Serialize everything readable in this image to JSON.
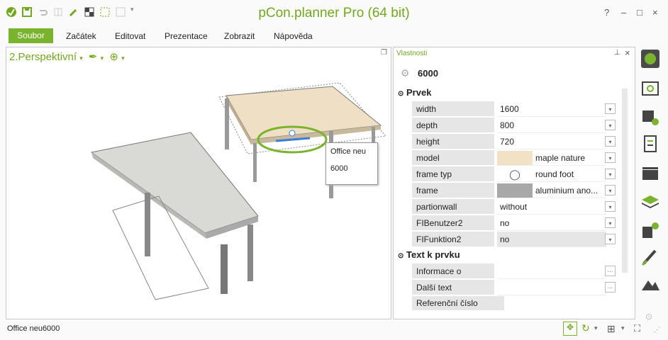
{
  "app": {
    "title": "pCon.planner Pro (64 bit)"
  },
  "window_controls": {
    "help": "?",
    "minimize": "–",
    "maximize": "□",
    "close": "×"
  },
  "menu": {
    "items": [
      "Soubor",
      "Začátek",
      "Editovat",
      "Prezentace",
      "Zobrazit",
      "Nápověda"
    ]
  },
  "viewport": {
    "title": "2.Perspektivní",
    "tooltip_name": "Office neu",
    "tooltip_id": "6000"
  },
  "properties": {
    "title": "Vlastnosti",
    "object_id": "6000",
    "group1": "Prvek",
    "rows": [
      {
        "name": "width",
        "value": "1600"
      },
      {
        "name": "depth",
        "value": "800"
      },
      {
        "name": "height",
        "value": "720"
      },
      {
        "name": "model",
        "value": "maple nature",
        "swatch": "#f1e2c6"
      },
      {
        "name": "frame typ",
        "value": "round foot",
        "radio": true
      },
      {
        "name": "frame",
        "value": "aluminium ano...",
        "swatch": "#a8a8a8"
      },
      {
        "name": "partionwall",
        "value": "without"
      },
      {
        "name": "FIBenutzer2",
        "value": "no"
      },
      {
        "name": "FIFunktion2",
        "value": "no",
        "disabled": true
      }
    ],
    "group2": "Text k prvku",
    "text_rows": [
      {
        "name": "Informace o speciá..."
      },
      {
        "name": "Další text"
      }
    ],
    "ref_label": "Referenční číslo"
  },
  "status": {
    "text": "Office neu6000"
  },
  "colors": {
    "accent": "#7ab32e",
    "title_green": "#72a81f"
  }
}
